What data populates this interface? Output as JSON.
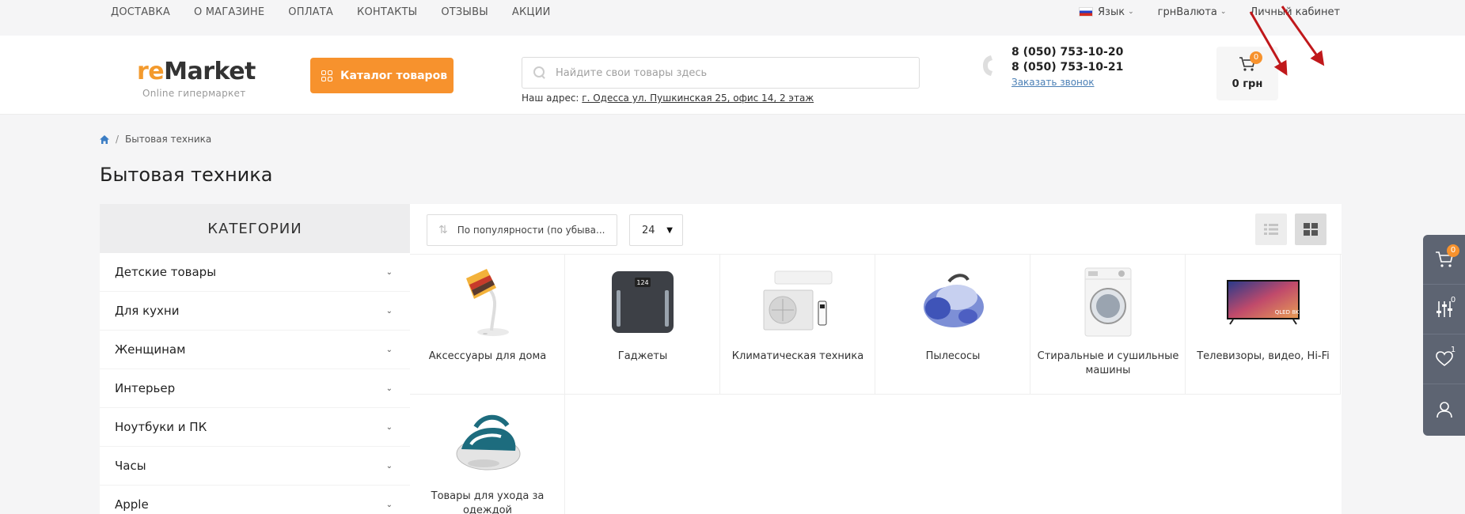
{
  "topbar": {
    "nav": [
      "ДОСТАВКА",
      "О МАГАЗИНЕ",
      "ОПЛАТА",
      "КОНТАКТЫ",
      "ОТЗЫВЫ",
      "АКЦИИ"
    ],
    "language": "Язык",
    "currency": "грнВалюта",
    "account": "Личный кабинет"
  },
  "header": {
    "logo_prefix": "re",
    "logo_main": "Market",
    "logo_sub": "Online гипермаркет",
    "catalog_button": "Каталог товаров",
    "search_placeholder": "Найдите свои товары здесь",
    "address_label": "Наш адрес:",
    "address_value": "г. Одесса ул. Пушкинская 25, офис 14, 2 этаж",
    "phone_1": "8 (050) 753-10-20",
    "phone_2": "8 (050) 753-10-21",
    "callback": "Заказать звонок",
    "cart_count": "0",
    "cart_sum": "0 грн"
  },
  "breadcrumb": {
    "current": "Бытовая техника"
  },
  "page_title": "Бытовая техника",
  "sidebar": {
    "title": "КАТЕГОРИИ",
    "items": [
      "Детские товары",
      "Для кухни",
      "Женщинам",
      "Интерьер",
      "Ноутбуки и ПК",
      "Часы",
      "Apple"
    ]
  },
  "toolbar": {
    "sort_label": "По популярности (по убыва...",
    "per_page": "24"
  },
  "categories": [
    "Аксессуары для дома",
    "Гаджеты",
    "Климатическая техника",
    "Пылесосы",
    "Стиральные и сушильные машины",
    "Телевизоры, видео, Hi-Fi",
    "Товары для ухода за одеждой"
  ],
  "tv_badge": "QLED 8K",
  "scale_display": "124",
  "sidepanel": {
    "cart_badge": "0",
    "compare_badge": "0",
    "wishlist_badge": "1"
  },
  "colors": {
    "accent": "#f7922d",
    "panel": "#5d6472",
    "link": "#4a7fb5"
  }
}
